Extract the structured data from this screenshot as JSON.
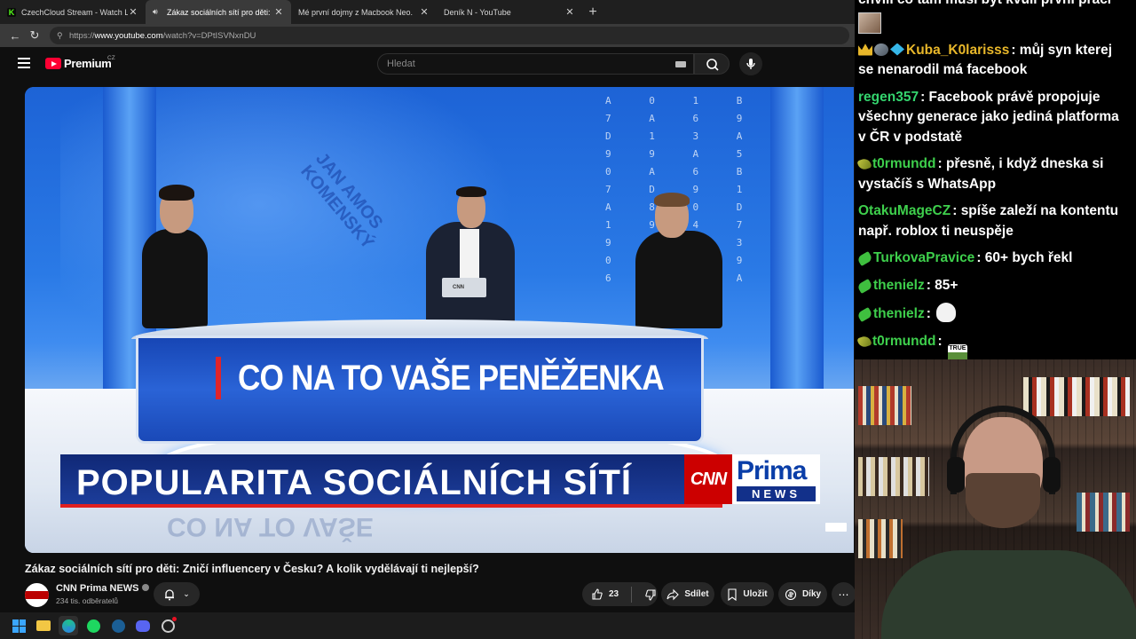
{
  "browser": {
    "tabs": [
      {
        "title": "CzechCloud Stream - Watch Live o",
        "icon": "kick-icon",
        "active": false
      },
      {
        "title": "Zákaz sociálních sítí pro děti:",
        "icon": "youtube-icon",
        "active": true,
        "audio": true
      },
      {
        "title": "Mé první dojmy z Macbook Neo.",
        "icon": "youtube-icon",
        "active": false
      },
      {
        "title": "Deník N - YouTube",
        "icon": "youtube-icon",
        "active": false
      }
    ],
    "url_prefix": "https://",
    "url_host": "www.youtube.com",
    "url_path": "/watch?v=DPtISVNxnDU"
  },
  "youtube": {
    "logo_text": "Premium",
    "country": "CZ",
    "search_placeholder": "Hledat",
    "video": {
      "desk_caption": "CO NA TO VAŠE PENĚŽENKA",
      "lower_third": "POPULARITA SOCIÁLNÍCH SÍTÍ",
      "brand_cnn": "CNN",
      "brand_prima": "Prima",
      "brand_news": "NEWS",
      "mirror_text": "CO NA TO VAŠE",
      "wall_text": "JAN AMOS KOMENSKÝ"
    },
    "title": "Zákaz sociálních sítí pro děti: Zničí influencery v Česku? A kolik vydělávají ti nejlepší?",
    "channel": {
      "name": "CNN Prima NEWS",
      "subscribers": "234 tis. odběratelů"
    },
    "actions": {
      "likes": "23",
      "share": "Sdílet",
      "save": "Uložit",
      "thanks": "Díky"
    }
  },
  "chat": {
    "messages": [
      {
        "user": "",
        "text": "chvíli co tam musí být kvůli první práci",
        "color": "#ffffff",
        "badges": []
      },
      {
        "user": "Kuba_K0larisss",
        "text": "můj syn kterej se nenarodil má facebook",
        "color": "#e8b72a",
        "badges": [
          "crown-badge",
          "gun-badge",
          "gem-badge"
        ]
      },
      {
        "user": "regen357",
        "text": "Facebook právě propojuje všechny generace jako jediná platforma v ČR v podstatě",
        "color": "#34d46e",
        "badges": []
      },
      {
        "user": "t0rmundd",
        "text": "přesně, i když dneska si vystačíš s WhatsApp",
        "color": "#3ecf4c",
        "badges": [
          "pickle-badge"
        ]
      },
      {
        "user": "OtakuMageCZ",
        "text": "spíše zaleží na kontentu např. roblox ti neuspěje",
        "color": "#3ecf4c",
        "badges": []
      },
      {
        "user": "TurkovaPravice",
        "text": "60+ bych řekl",
        "color": "#3ecf4c",
        "badges": [
          "green-badge"
        ]
      },
      {
        "user": "thenielz",
        "text": "85+",
        "color": "#3ecf4c",
        "badges": [
          "green-badge"
        ]
      },
      {
        "user": "thenielz",
        "text": "",
        "color": "#3ecf4c",
        "badges": [
          "green-badge"
        ],
        "emote": "face-emote"
      },
      {
        "user": "t0rmundd",
        "text": "",
        "color": "#3ecf4c",
        "badges": [
          "pickle-badge"
        ],
        "emote": "true-emote",
        "emote_text": "TRUE"
      }
    ]
  }
}
